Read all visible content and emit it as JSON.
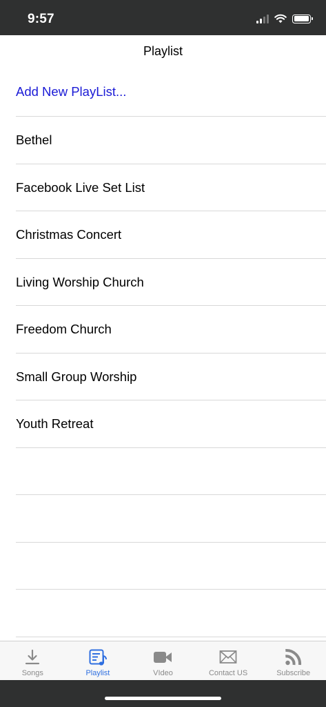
{
  "status": {
    "time": "9:57"
  },
  "nav": {
    "title": "Playlist"
  },
  "add_label": "Add New PlayList...",
  "playlists": [
    "Bethel",
    "Facebook Live Set List",
    "Christmas Concert",
    "Living Worship Church",
    "Freedom Church",
    "Small Group Worship",
    "Youth Retreat"
  ],
  "tabs": [
    {
      "label": "Songs",
      "icon": "download-icon"
    },
    {
      "label": "Playlist",
      "icon": "playlist-icon",
      "active": true
    },
    {
      "label": "VIdeo",
      "icon": "video-camera-icon"
    },
    {
      "label": "Contact US",
      "icon": "envelope-icon"
    },
    {
      "label": "Subscribe",
      "icon": "rss-icon"
    }
  ],
  "colors": {
    "accent": "#2f6fe0",
    "add_link": "#1a1ad6",
    "status_bar": "#2f3030",
    "inactive_tab": "#8a8a8a"
  }
}
